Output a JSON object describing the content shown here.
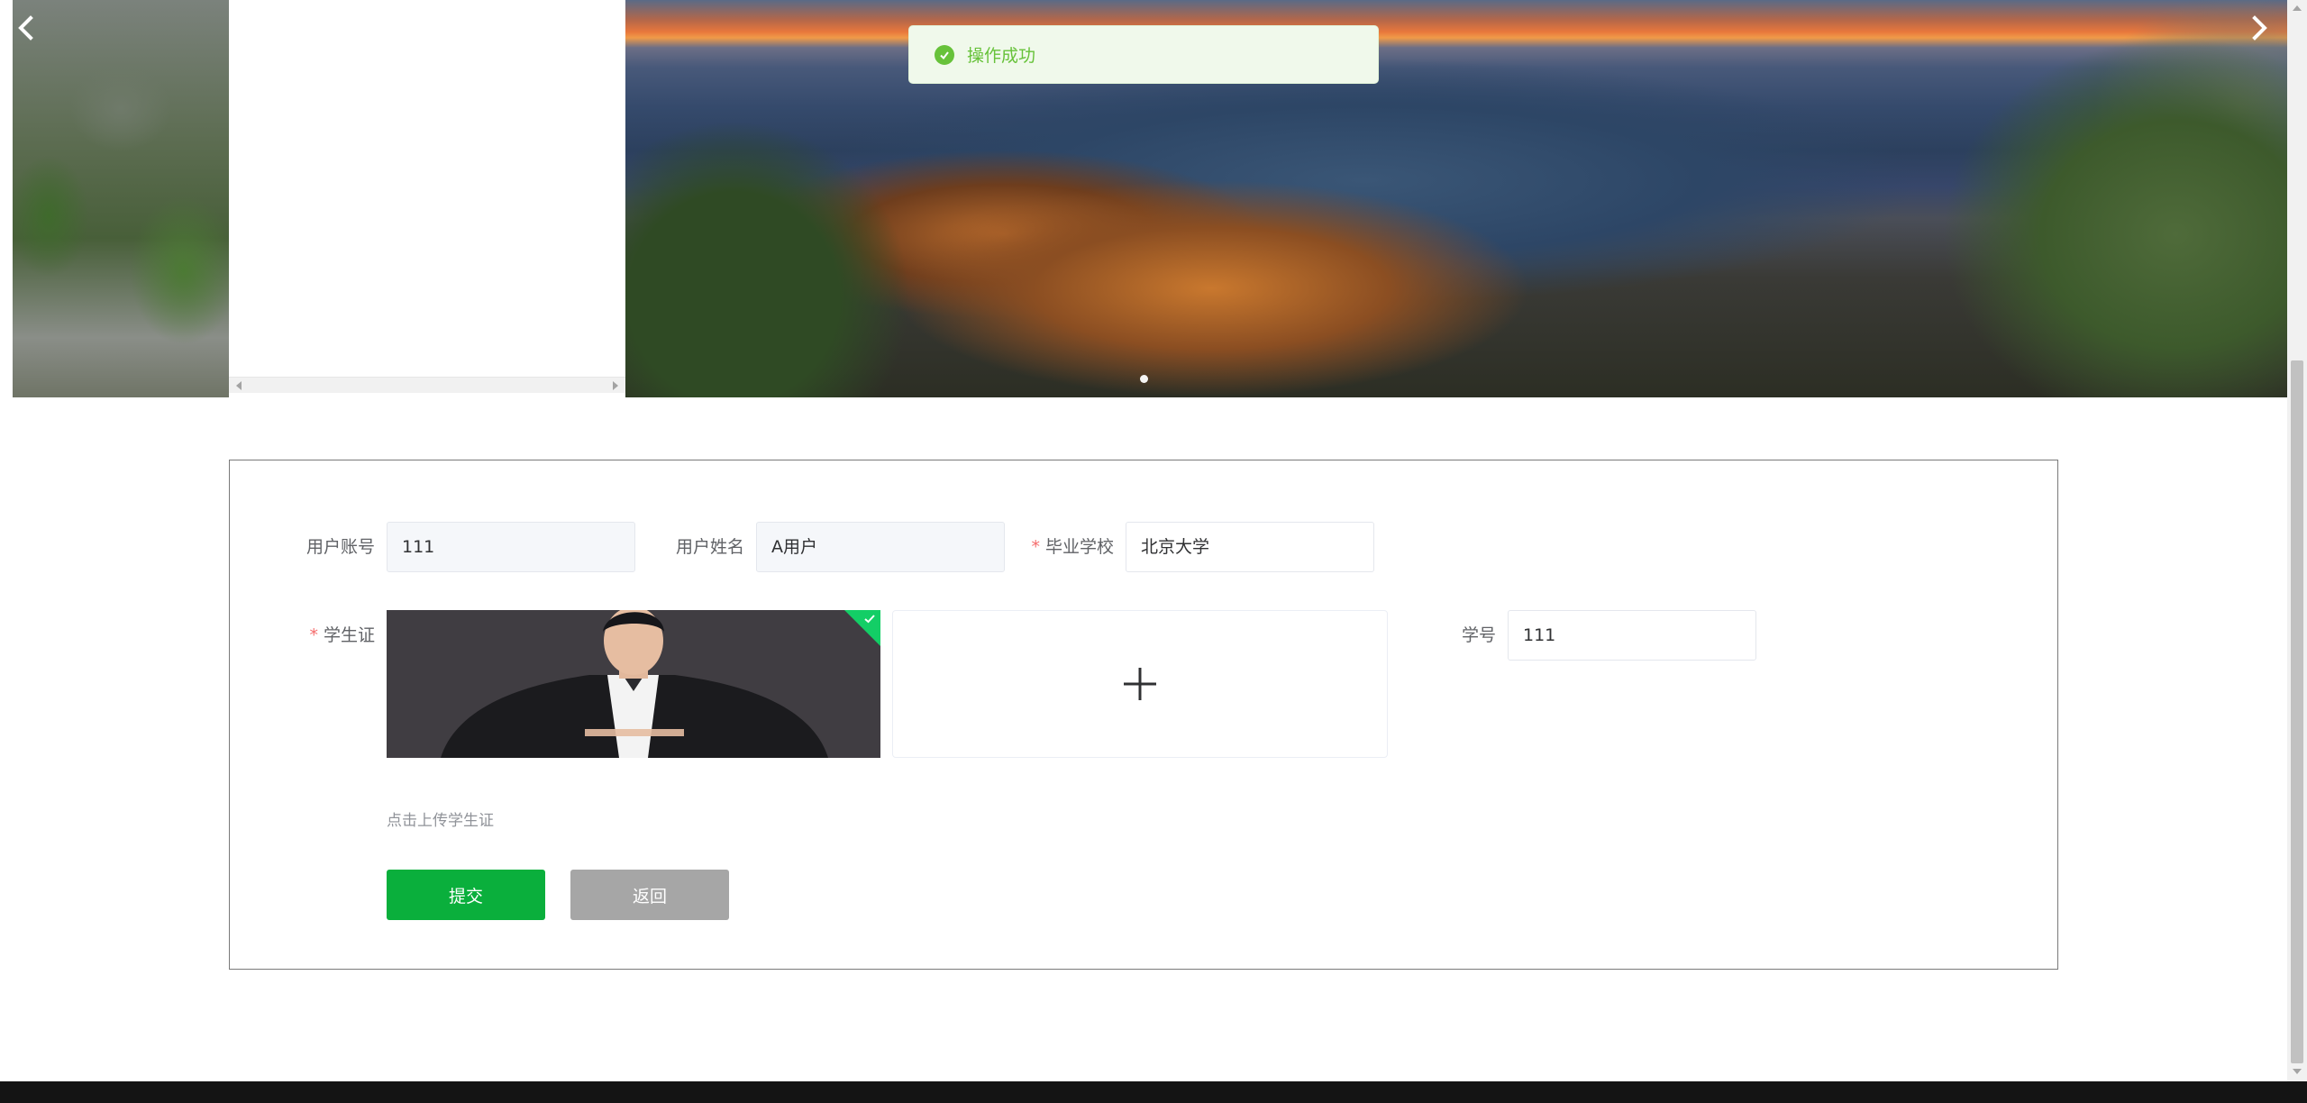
{
  "toast": {
    "message": "操作成功"
  },
  "carousel": {
    "slide_count": 1,
    "active_index": 0
  },
  "form": {
    "account_label": "用户账号",
    "account_value": "111",
    "name_label": "用户姓名",
    "name_value": "A用户",
    "school_label": "毕业学校",
    "school_value": "北京大学",
    "student_card_label": "学生证",
    "student_card_tip": "点击上传学生证",
    "student_no_label": "学号",
    "student_no_value": "111",
    "required_mark": "*"
  },
  "buttons": {
    "submit": "提交",
    "back": "返回"
  },
  "colors": {
    "success": "#67c23a",
    "submit_bg": "#0aaf3c",
    "back_bg": "#a6a6a6",
    "required": "#f56c6c"
  }
}
